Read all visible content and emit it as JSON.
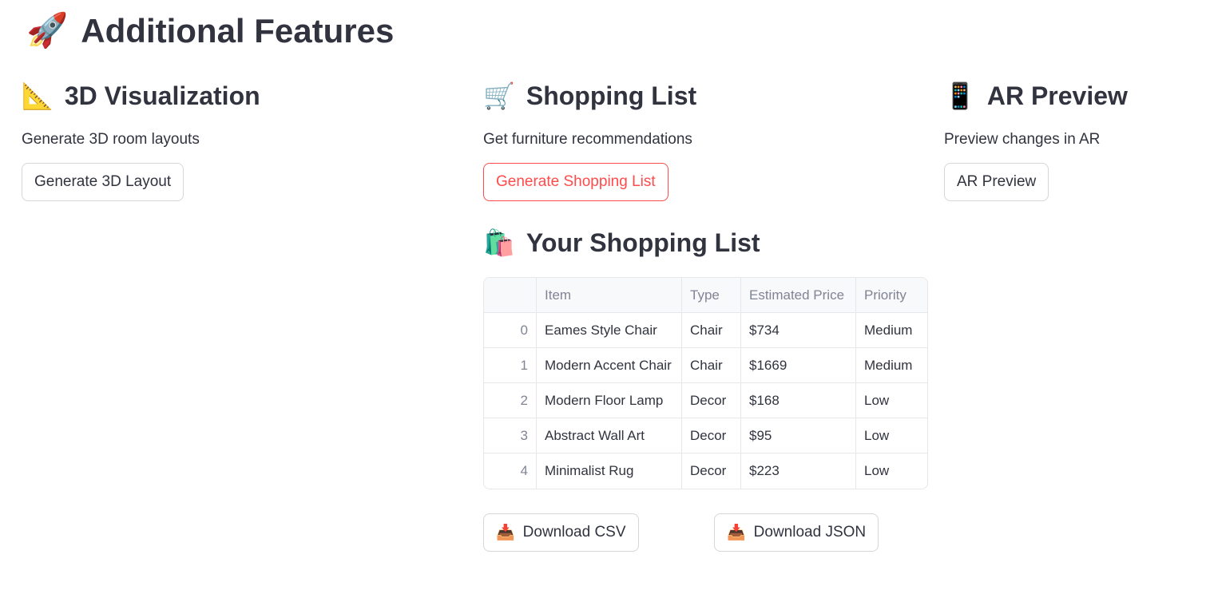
{
  "page_title": "Additional Features",
  "icons": {
    "title": "🚀",
    "visualization": "📐",
    "shopping": "🛒",
    "ar": "📱",
    "shopping_list": "🛍️",
    "download": "📥"
  },
  "visualization": {
    "title": "3D Visualization",
    "description": "Generate 3D room layouts",
    "button_label": "Generate 3D Layout"
  },
  "shopping": {
    "title": "Shopping List",
    "description": "Get furniture recommendations",
    "button_label": "Generate Shopping List"
  },
  "ar": {
    "title": "AR Preview",
    "description": "Preview changes in AR",
    "button_label": "AR Preview"
  },
  "shopping_list": {
    "title": "Your Shopping List",
    "columns": [
      "",
      "Item",
      "Type",
      "Estimated Price",
      "Priority"
    ],
    "rows": [
      {
        "index": "0",
        "item": "Eames Style Chair",
        "type": "Chair",
        "price": "$734",
        "priority": "Medium"
      },
      {
        "index": "1",
        "item": "Modern Accent Chair",
        "type": "Chair",
        "price": "$1669",
        "priority": "Medium"
      },
      {
        "index": "2",
        "item": "Modern Floor Lamp",
        "type": "Decor",
        "price": "$168",
        "priority": "Low"
      },
      {
        "index": "3",
        "item": "Abstract Wall Art",
        "type": "Decor",
        "price": "$95",
        "priority": "Low"
      },
      {
        "index": "4",
        "item": "Minimalist Rug",
        "type": "Decor",
        "price": "$223",
        "priority": "Low"
      }
    ],
    "download_csv_label": "Download CSV",
    "download_json_label": "Download JSON"
  },
  "colors": {
    "accent": "#ff4b4b",
    "text": "#31333f",
    "muted": "#808495",
    "border": "#d5d6d9"
  }
}
